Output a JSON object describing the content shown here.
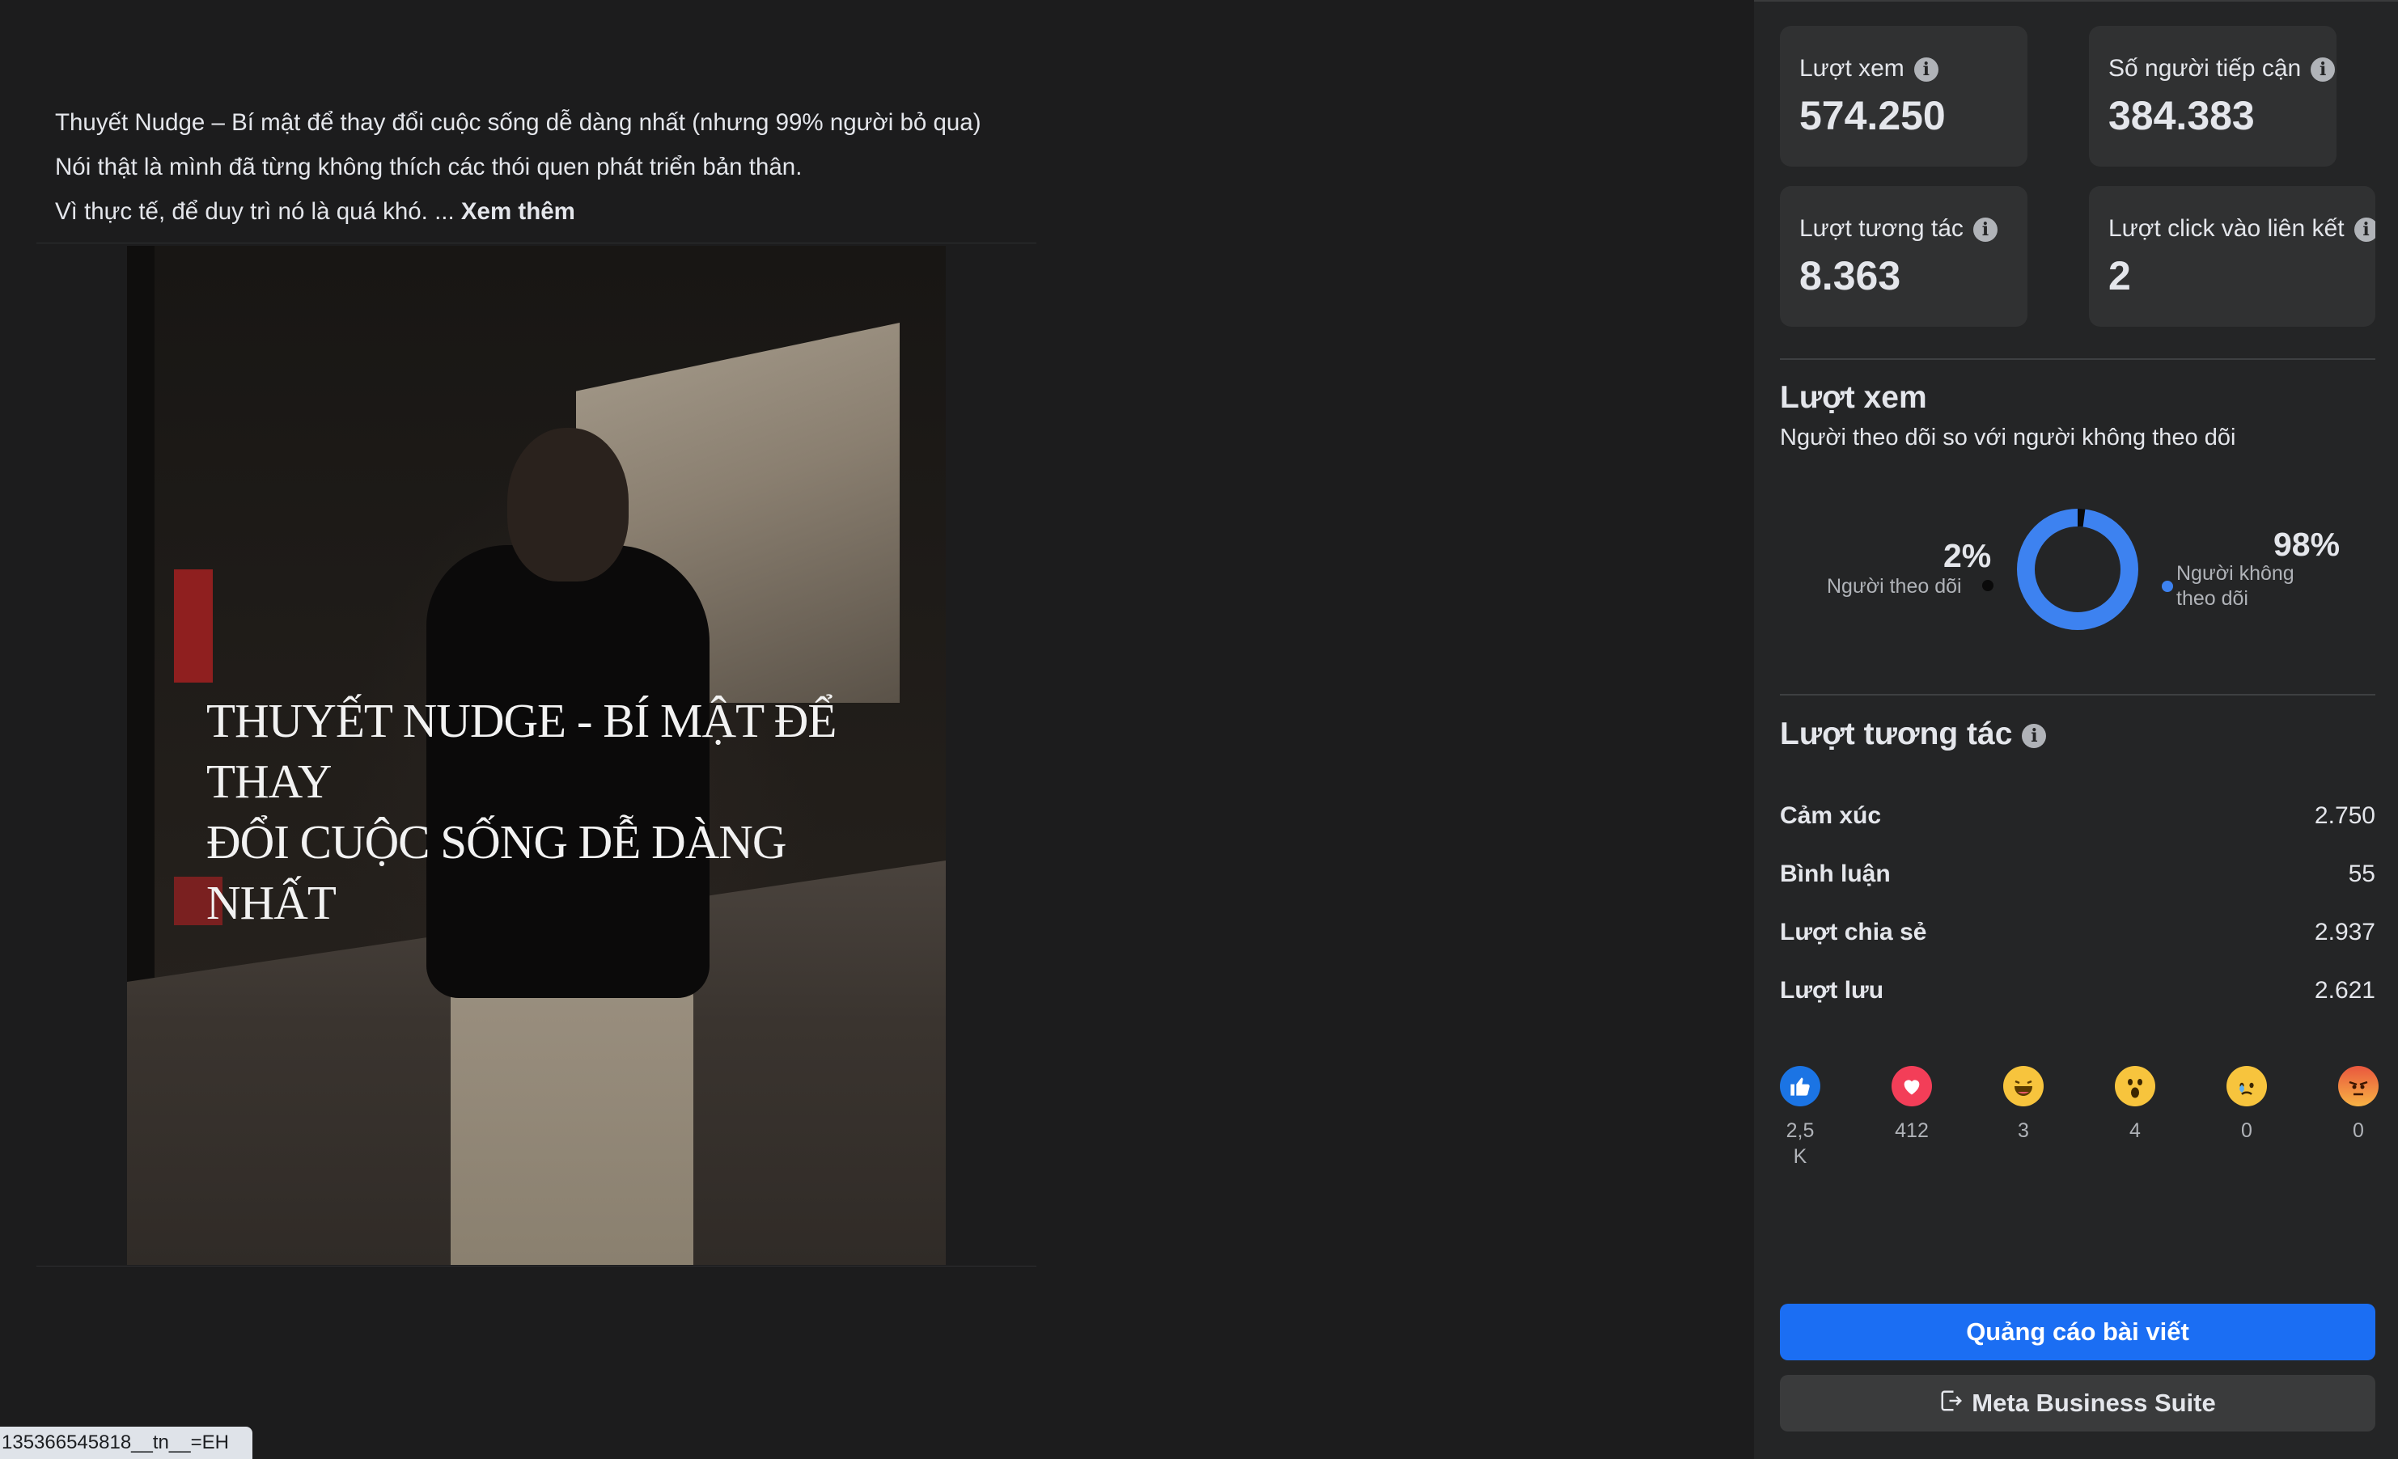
{
  "post": {
    "line1": "Thuyết Nudge – Bí mật để thay đổi cuộc sống dễ dàng nhất (nhưng 99% người bỏ qua)",
    "line2": "Nói thật là mình đã từng không thích các thói quen phát triển bản thân.",
    "line3": "Vì thực tế, để duy trì nó là quá khó. ...",
    "see_more": "Xem thêm",
    "image_title_line1": "THUYẾT NUDGE - BÍ MẬT ĐỂ THAY",
    "image_title_line2": "ĐỔI CUỘC SỐNG DỄ DÀNG NHẤT"
  },
  "status_url": "135366545818__tn__=EH",
  "stats": {
    "views_label": "Lượt xem",
    "views_value": "574.250",
    "reach_label": "Số người tiếp cận",
    "reach_value": "384.383",
    "engagement_label": "Lượt tương tác",
    "engagement_value": "8.363",
    "link_clicks_label": "Lượt click vào liên kết",
    "link_clicks_value": "2"
  },
  "views_section": {
    "title": "Lượt xem",
    "subtitle": "Người theo dõi so với người không theo dõi",
    "followers_pct": "2%",
    "followers_label": "Người theo dõi",
    "non_followers_pct": "98%",
    "non_followers_label_line1": "Người không",
    "non_followers_label_line2": "theo dõi",
    "followers_fraction": 0.02,
    "colors": {
      "followers": "#0a0a0a",
      "non_followers": "#3d82f0"
    }
  },
  "engagement_section": {
    "title": "Lượt tương tác",
    "rows": [
      {
        "label": "Cảm xúc",
        "value": "2.750"
      },
      {
        "label": "Bình luận",
        "value": "55"
      },
      {
        "label": "Lượt chia sẻ",
        "value": "2.937"
      },
      {
        "label": "Lượt lưu",
        "value": "2.621"
      }
    ],
    "reactions": [
      {
        "icon": "like-icon",
        "count": "2,5\nK",
        "count_line1": "2,5",
        "count_line2": "K"
      },
      {
        "icon": "love-icon",
        "count_line1": "412"
      },
      {
        "icon": "haha-icon",
        "count_line1": "3"
      },
      {
        "icon": "wow-icon",
        "count_line1": "4"
      },
      {
        "icon": "sad-icon",
        "count_line1": "0"
      },
      {
        "icon": "angry-icon",
        "count_line1": "0"
      }
    ]
  },
  "buttons": {
    "boost": "Quảng cáo bài viết",
    "meta_suite": "Meta Business Suite"
  }
}
